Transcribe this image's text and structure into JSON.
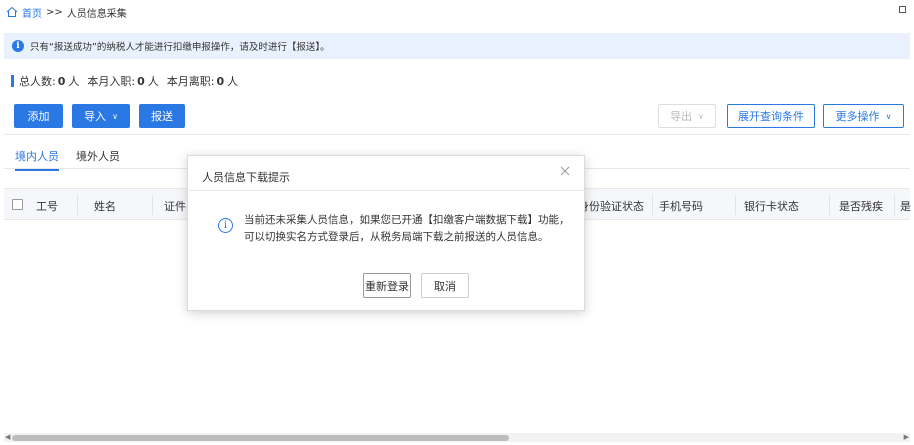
{
  "breadcrumb": {
    "home": "首页",
    "separator": ">>",
    "current": "人员信息采集"
  },
  "notice": {
    "icon": "i",
    "text": "只有“报送成功”的纳税人才能进行扣缴申报操作，请及时进行【报送】。"
  },
  "stats": {
    "total_label": "总人数:",
    "total_value": "0",
    "total_unit": "人",
    "hired_label": "本月入职:",
    "hired_value": "0",
    "hired_unit": "人",
    "left_label": "本月离职:",
    "left_value": "0",
    "left_unit": "人"
  },
  "toolbar": {
    "add": "添加",
    "import": "导入",
    "submit": "报送",
    "export": "导出",
    "expand_query": "展开查询条件",
    "more_actions": "更多操作"
  },
  "tabs": {
    "domestic": "境内人员",
    "foreign": "境外人员"
  },
  "table": {
    "columns": [
      "工号",
      "姓名",
      "证件",
      "身份验证状态",
      "手机号码",
      "银行卡状态",
      "是否残疾",
      "是"
    ]
  },
  "dialog": {
    "title": "人员信息下载提示",
    "info_icon": "i",
    "message": "当前还未采集人员信息，如果您已开通【扣缴客户端数据下载】功能，可以切换实名方式登录后，从税务局端下载之前报送的人员信息。",
    "relogin": "重新登录",
    "cancel": "取消"
  },
  "colors": {
    "accent": "#2a78e4",
    "notice_bg": "#e8f1fd",
    "header_bg": "#f5f7fa"
  }
}
